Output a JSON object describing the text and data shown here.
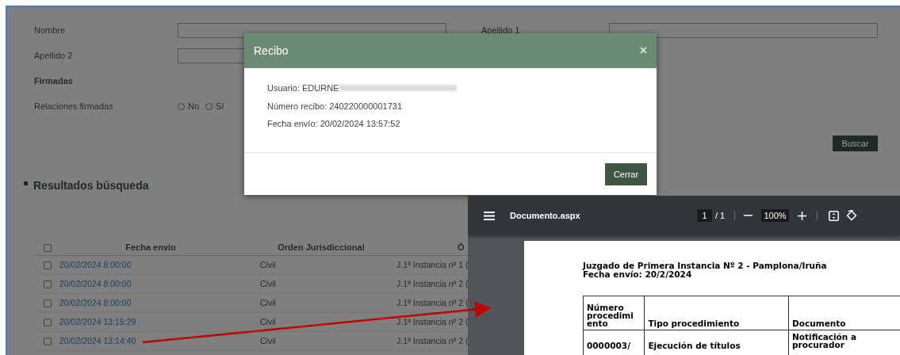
{
  "search_form": {
    "fields": [
      {
        "label": "Nombre"
      },
      {
        "label": "Apellido 1"
      },
      {
        "label": "Apellido 2"
      }
    ],
    "section_label": "Firmadas",
    "radio_group": {
      "label": "Relaciones firmadas",
      "options": [
        {
          "label": "No",
          "selected": false
        },
        {
          "label": "Sí",
          "selected": false
        }
      ]
    },
    "search_button": "Buscar"
  },
  "results": {
    "title": "Resultados búsqueda",
    "table": {
      "select_all_checked": false,
      "columns": [
        "Fecha envio",
        "Orden Jurisdiccional",
        "Ó"
      ],
      "rows": [
        {
          "checked": false,
          "date": "20/02/2024 8:00:00",
          "order": "Civil",
          "court": "J.1ª Instancia nº 1 ("
        },
        {
          "checked": false,
          "date": "20/02/2024 8:00:00",
          "order": "Civil",
          "court": "J.1ª Instancia nº 2 ("
        },
        {
          "checked": false,
          "date": "20/02/2024 8:00:00",
          "order": "Civil",
          "court": "J.1ª Instancia nº 2 ("
        },
        {
          "checked": false,
          "date": "20/02/2024 13:15:29",
          "order": "Civil",
          "court": "J.1ª Instancia nº 2 ("
        },
        {
          "checked": false,
          "date": "20/02/2024 13:14:40",
          "order": "Civil",
          "court": "J.1ª Instancia nº 2 ("
        }
      ]
    }
  },
  "modal": {
    "title": "Recibo",
    "close_icon": "×",
    "lines": [
      "Usuario: EDURNE",
      "Número recibo: 240220000001731",
      "Fecha envío: 20/02/2024 13:57:52"
    ],
    "button": "Cerrar"
  },
  "pdf_viewer": {
    "file_name": "Documento.aspx",
    "page": "1",
    "page_total": "/ 1",
    "zoom": "100%",
    "document": {
      "heading_lines": [
        "Juzgado de Primera Instancia Nº 2 - Pamplona/Iruña",
        "Fecha envío: 20/2/2024"
      ],
      "table": {
        "columns": [
          "Número procedimi ento",
          "Tipo procedimiento",
          "Documento"
        ],
        "rows": [
          [
            "0000003/",
            "Ejecución de títulos",
            "Notificación a procurador"
          ]
        ]
      }
    }
  }
}
